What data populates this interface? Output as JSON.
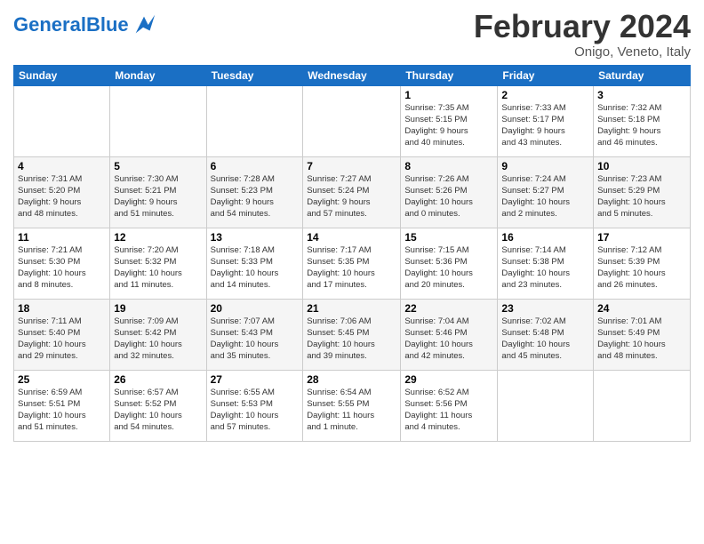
{
  "header": {
    "logo_general": "General",
    "logo_blue": "Blue",
    "title": "February 2024",
    "subtitle": "Onigo, Veneto, Italy"
  },
  "weekdays": [
    "Sunday",
    "Monday",
    "Tuesday",
    "Wednesday",
    "Thursday",
    "Friday",
    "Saturday"
  ],
  "weeks": [
    [
      {
        "day": "",
        "info": ""
      },
      {
        "day": "",
        "info": ""
      },
      {
        "day": "",
        "info": ""
      },
      {
        "day": "",
        "info": ""
      },
      {
        "day": "1",
        "info": "Sunrise: 7:35 AM\nSunset: 5:15 PM\nDaylight: 9 hours\nand 40 minutes."
      },
      {
        "day": "2",
        "info": "Sunrise: 7:33 AM\nSunset: 5:17 PM\nDaylight: 9 hours\nand 43 minutes."
      },
      {
        "day": "3",
        "info": "Sunrise: 7:32 AM\nSunset: 5:18 PM\nDaylight: 9 hours\nand 46 minutes."
      }
    ],
    [
      {
        "day": "4",
        "info": "Sunrise: 7:31 AM\nSunset: 5:20 PM\nDaylight: 9 hours\nand 48 minutes."
      },
      {
        "day": "5",
        "info": "Sunrise: 7:30 AM\nSunset: 5:21 PM\nDaylight: 9 hours\nand 51 minutes."
      },
      {
        "day": "6",
        "info": "Sunrise: 7:28 AM\nSunset: 5:23 PM\nDaylight: 9 hours\nand 54 minutes."
      },
      {
        "day": "7",
        "info": "Sunrise: 7:27 AM\nSunset: 5:24 PM\nDaylight: 9 hours\nand 57 minutes."
      },
      {
        "day": "8",
        "info": "Sunrise: 7:26 AM\nSunset: 5:26 PM\nDaylight: 10 hours\nand 0 minutes."
      },
      {
        "day": "9",
        "info": "Sunrise: 7:24 AM\nSunset: 5:27 PM\nDaylight: 10 hours\nand 2 minutes."
      },
      {
        "day": "10",
        "info": "Sunrise: 7:23 AM\nSunset: 5:29 PM\nDaylight: 10 hours\nand 5 minutes."
      }
    ],
    [
      {
        "day": "11",
        "info": "Sunrise: 7:21 AM\nSunset: 5:30 PM\nDaylight: 10 hours\nand 8 minutes."
      },
      {
        "day": "12",
        "info": "Sunrise: 7:20 AM\nSunset: 5:32 PM\nDaylight: 10 hours\nand 11 minutes."
      },
      {
        "day": "13",
        "info": "Sunrise: 7:18 AM\nSunset: 5:33 PM\nDaylight: 10 hours\nand 14 minutes."
      },
      {
        "day": "14",
        "info": "Sunrise: 7:17 AM\nSunset: 5:35 PM\nDaylight: 10 hours\nand 17 minutes."
      },
      {
        "day": "15",
        "info": "Sunrise: 7:15 AM\nSunset: 5:36 PM\nDaylight: 10 hours\nand 20 minutes."
      },
      {
        "day": "16",
        "info": "Sunrise: 7:14 AM\nSunset: 5:38 PM\nDaylight: 10 hours\nand 23 minutes."
      },
      {
        "day": "17",
        "info": "Sunrise: 7:12 AM\nSunset: 5:39 PM\nDaylight: 10 hours\nand 26 minutes."
      }
    ],
    [
      {
        "day": "18",
        "info": "Sunrise: 7:11 AM\nSunset: 5:40 PM\nDaylight: 10 hours\nand 29 minutes."
      },
      {
        "day": "19",
        "info": "Sunrise: 7:09 AM\nSunset: 5:42 PM\nDaylight: 10 hours\nand 32 minutes."
      },
      {
        "day": "20",
        "info": "Sunrise: 7:07 AM\nSunset: 5:43 PM\nDaylight: 10 hours\nand 35 minutes."
      },
      {
        "day": "21",
        "info": "Sunrise: 7:06 AM\nSunset: 5:45 PM\nDaylight: 10 hours\nand 39 minutes."
      },
      {
        "day": "22",
        "info": "Sunrise: 7:04 AM\nSunset: 5:46 PM\nDaylight: 10 hours\nand 42 minutes."
      },
      {
        "day": "23",
        "info": "Sunrise: 7:02 AM\nSunset: 5:48 PM\nDaylight: 10 hours\nand 45 minutes."
      },
      {
        "day": "24",
        "info": "Sunrise: 7:01 AM\nSunset: 5:49 PM\nDaylight: 10 hours\nand 48 minutes."
      }
    ],
    [
      {
        "day": "25",
        "info": "Sunrise: 6:59 AM\nSunset: 5:51 PM\nDaylight: 10 hours\nand 51 minutes."
      },
      {
        "day": "26",
        "info": "Sunrise: 6:57 AM\nSunset: 5:52 PM\nDaylight: 10 hours\nand 54 minutes."
      },
      {
        "day": "27",
        "info": "Sunrise: 6:55 AM\nSunset: 5:53 PM\nDaylight: 10 hours\nand 57 minutes."
      },
      {
        "day": "28",
        "info": "Sunrise: 6:54 AM\nSunset: 5:55 PM\nDaylight: 11 hours\nand 1 minute."
      },
      {
        "day": "29",
        "info": "Sunrise: 6:52 AM\nSunset: 5:56 PM\nDaylight: 11 hours\nand 4 minutes."
      },
      {
        "day": "",
        "info": ""
      },
      {
        "day": "",
        "info": ""
      }
    ]
  ]
}
